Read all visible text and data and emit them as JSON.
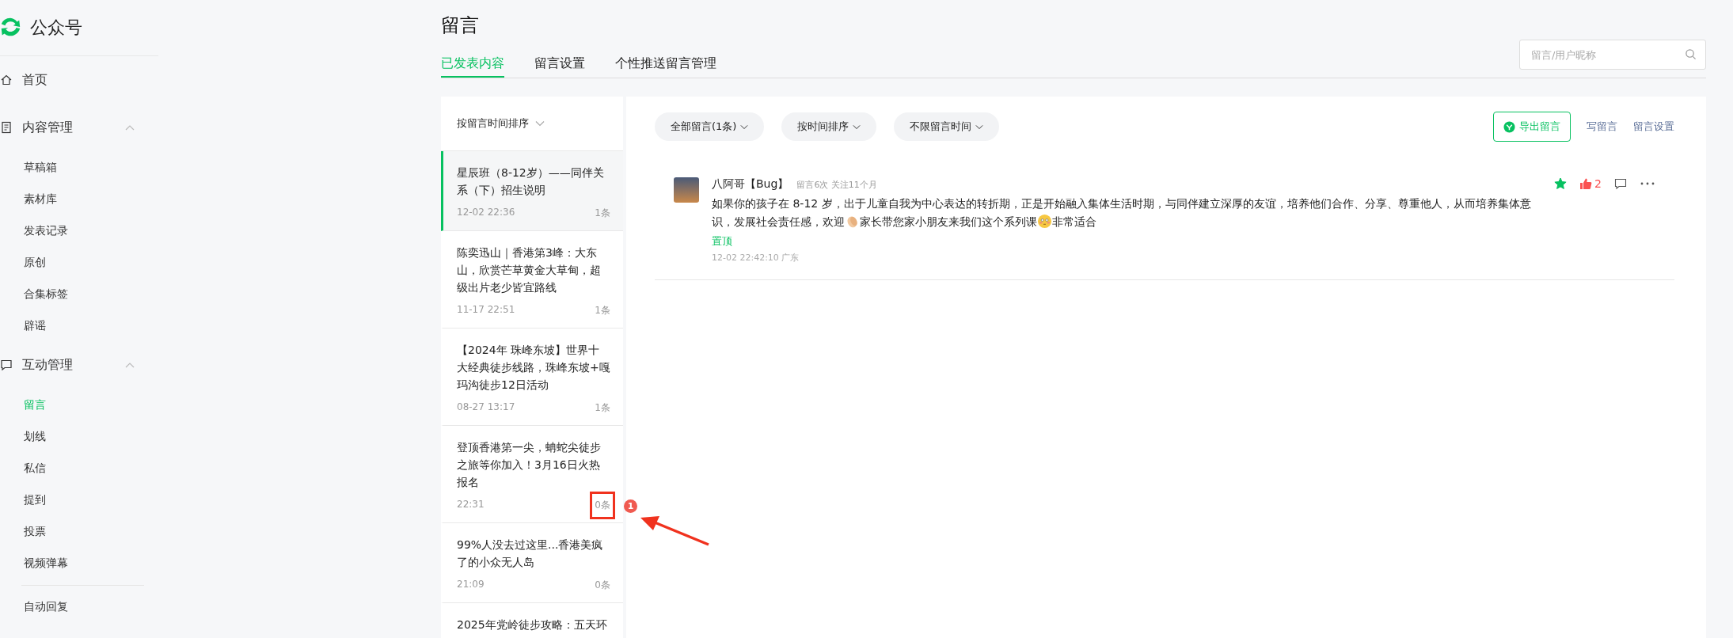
{
  "sidebar": {
    "logo_text": "公众号",
    "items": [
      {
        "kind": "top",
        "label": "首页"
      },
      {
        "kind": "group",
        "label": "内容管理",
        "expanded": true,
        "children": [
          {
            "label": "草稿箱",
            "selected": false
          },
          {
            "label": "素材库",
            "selected": false
          },
          {
            "label": "发表记录",
            "selected": false
          },
          {
            "label": "原创",
            "selected": false
          },
          {
            "label": "合集标签",
            "selected": false
          },
          {
            "label": "辟谣",
            "selected": false
          }
        ]
      },
      {
        "kind": "group",
        "label": "互动管理",
        "expanded": true,
        "children": [
          {
            "label": "留言",
            "selected": true
          },
          {
            "label": "划线",
            "selected": false
          },
          {
            "label": "私信",
            "selected": false
          },
          {
            "label": "提到",
            "selected": false
          },
          {
            "label": "投票",
            "selected": false
          },
          {
            "label": "视频弹幕",
            "selected": false
          }
        ]
      },
      {
        "kind": "plain",
        "label": "自动回复"
      }
    ]
  },
  "page_title": "留言",
  "tabs": [
    {
      "label": "已发表内容",
      "selected": true
    },
    {
      "label": "留言设置",
      "selected": false
    },
    {
      "label": "个性推送留言管理",
      "selected": false
    }
  ],
  "search": {
    "placeholder": "留言/用户昵称"
  },
  "article_list": {
    "sort": "按留言时间排序",
    "articles": [
      {
        "title": "星辰班（8-12岁）——同伴关系（下）招生说明",
        "time": "12-02 22:36",
        "count": "1条",
        "selected": true
      },
      {
        "title": "陈奕迅山｜香港第3峰：大东山，欣赏芒草黄金大草甸，超级出片老少皆宜路线",
        "time": "11-17 22:51",
        "count": "1条",
        "selected": false
      },
      {
        "title": "【2024年 珠峰东坡】世界十大经典徒步线路，珠峰东坡+嘎玛沟徒步12日活动",
        "time": "08-27 13:17",
        "count": "1条",
        "selected": false
      },
      {
        "title": "登顶香港第一尖，蚺蛇尖徒步之旅等你加入！3月16日火热报名",
        "time": "22:31",
        "count": "0条",
        "selected": false,
        "annotation": "1"
      },
      {
        "title": "99%人没去过这里...香港美疯了的小众无人岛",
        "time": "21:09",
        "count": "0条",
        "selected": false
      },
      {
        "title": "2025年党岭徒步攻略：五天环",
        "selected": false
      }
    ]
  },
  "filters": [
    "全部留言(1条)",
    "按时间排序",
    "不限留言时间"
  ],
  "actions": {
    "export": "导出留言",
    "write": "写留言",
    "settings": "留言设置"
  },
  "comments": [
    {
      "user": "八阿哥【Bug】",
      "meta": "留言6次 关注11个月",
      "body": [
        {
          "kind": "text",
          "text": "如果你的孩子在 8-12 岁，出于儿童自我为中心表达的转折期，正是开始融入集体生活时期，与同伴建立深厚的友谊，培养他们合作、分享、尊重他人，从而培养集体意识，发展社会责任感，欢迎"
        },
        {
          "kind": "clap"
        },
        {
          "kind": "text",
          "text": "家长带您家小朋友来我们这个系列课"
        },
        {
          "kind": "blush"
        },
        {
          "kind": "text",
          "text": "非常适合"
        }
      ],
      "pinned_label": "置顶",
      "time": "12-02 22:42:10 广东",
      "starred": true,
      "likes": "2"
    }
  ]
}
